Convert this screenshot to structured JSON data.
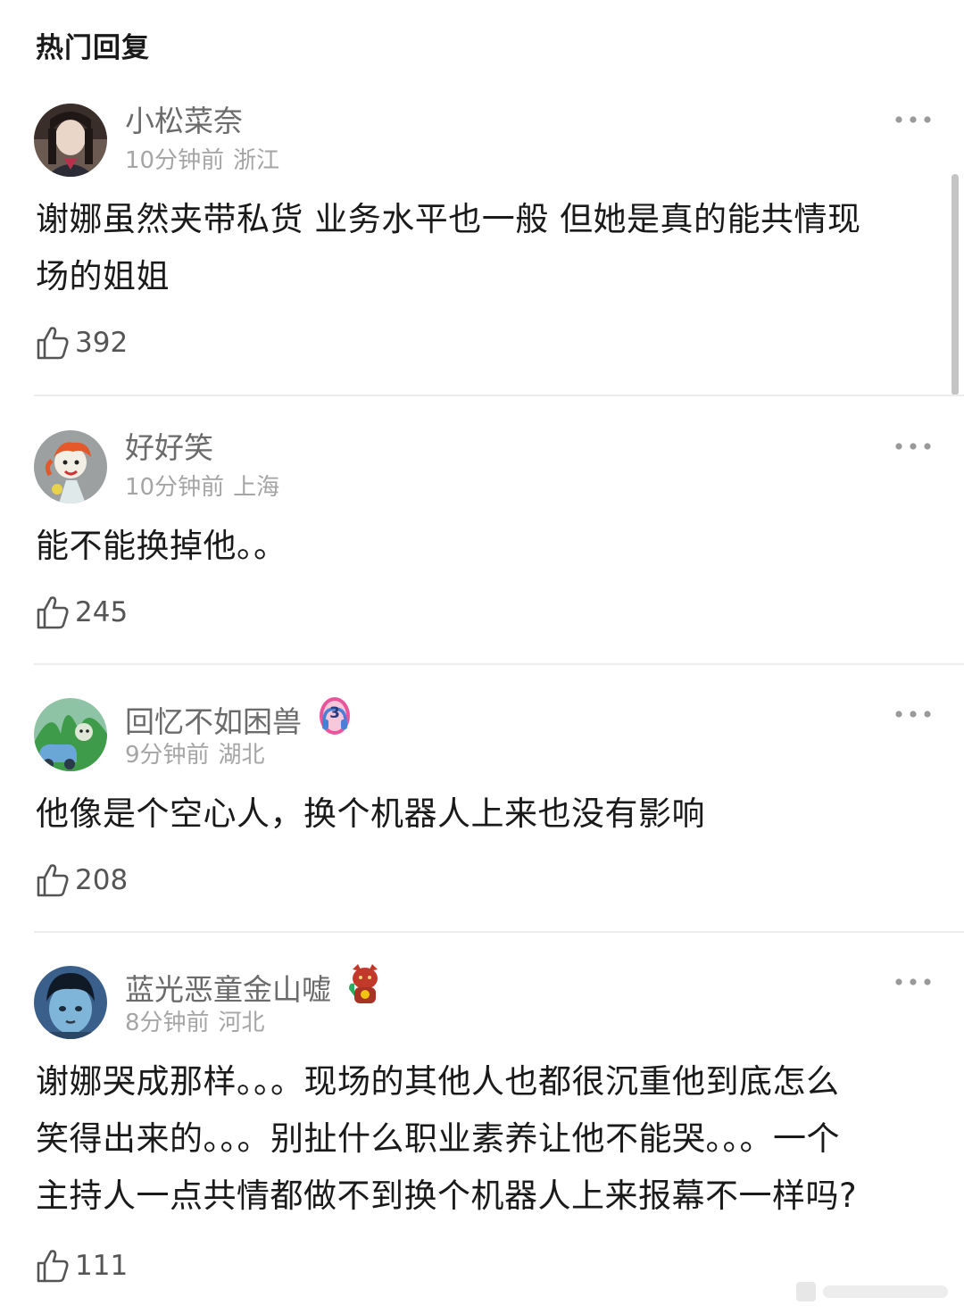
{
  "header": {
    "title": "热门回复"
  },
  "comments": [
    {
      "username": "小松菜奈",
      "time": "10分钟前",
      "location": "浙江",
      "lines": [
        "谢娜虽然夹带私货 业务水平也一般 但她是真的能共情现",
        "场的姐姐"
      ],
      "likes": "392"
    },
    {
      "username": "好好笑",
      "time": "10分钟前",
      "location": "上海",
      "lines": [
        "能不能换掉他。。"
      ],
      "likes": "245"
    },
    {
      "username": "回忆不如困兽",
      "time": "9分钟前",
      "location": "湖北",
      "badge_text": "3",
      "lines": [
        "他像是个空心人，换个机器人上来也没有影响"
      ],
      "likes": "208"
    },
    {
      "username": "蓝光恶童金山嘘",
      "time": "8分钟前",
      "location": "河北",
      "lines": [
        "谢娜哭成那样。。。现场的其他人也都很沉重他到底怎么",
        "笑得出来的。。。别扯什么职业素养让他不能哭。。。一个",
        "主持人一点共情都做不到换个机器人上来报幕不一样吗?"
      ],
      "likes": "111"
    }
  ],
  "colors": {
    "username": "#6b6b6b",
    "meta": "#a5a5a5",
    "body": "#1a1a1a",
    "divider": "#ececec",
    "badge_pink": "#e9559b",
    "badge_blue": "#4a7fd6"
  },
  "icons": {
    "like": "thumbs-up-outline-icon",
    "more": "more-horizontal-dots-icon"
  }
}
